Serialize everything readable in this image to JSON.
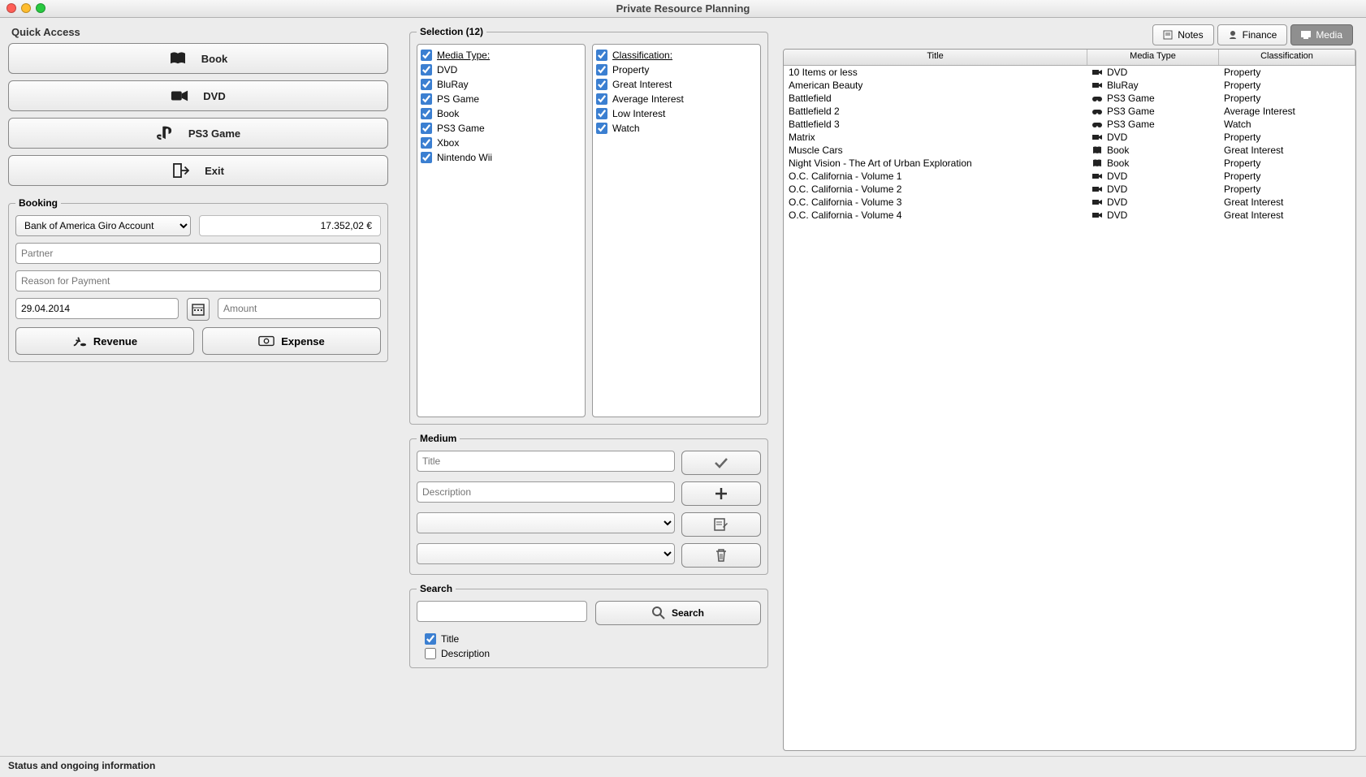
{
  "window": {
    "title": "Private Resource Planning"
  },
  "quick": {
    "title": "Quick Access",
    "book": "Book",
    "dvd": "DVD",
    "ps3": "PS3 Game",
    "exit": "Exit"
  },
  "booking": {
    "title": "Booking",
    "account": "Bank of America Giro Account",
    "balance": "17.352,02 €",
    "partner_ph": "Partner",
    "reason_ph": "Reason for Payment",
    "date": "29.04.2014",
    "amount_ph": "Amount",
    "revenue": "Revenue",
    "expense": "Expense"
  },
  "selection": {
    "title": "Selection (12)",
    "media_hdr": "Media Type:",
    "class_hdr": "Classification:",
    "media": [
      "DVD",
      "BluRay",
      "PS Game",
      "Book",
      "PS3 Game",
      "Xbox",
      "Nintendo Wii"
    ],
    "class": [
      "Property",
      "Great Interest",
      "Average Interest",
      "Low Interest",
      "Watch"
    ]
  },
  "medium": {
    "title": "Medium",
    "title_ph": "Title",
    "desc_ph": "Description"
  },
  "search": {
    "title": "Search",
    "btn": "Search",
    "chk_title": "Title",
    "chk_desc": "Description"
  },
  "tabs": {
    "notes": "Notes",
    "finance": "Finance",
    "media": "Media"
  },
  "table": {
    "headers": {
      "title": "Title",
      "mtype": "Media Type",
      "class": "Classification"
    },
    "rows": [
      {
        "title": "10 Items or less",
        "mtype": "DVD",
        "class": "Property",
        "icon": "dvd"
      },
      {
        "title": "American Beauty",
        "mtype": "BluRay",
        "class": "Property",
        "icon": "dvd"
      },
      {
        "title": "Battlefield",
        "mtype": "PS3 Game",
        "class": "Property",
        "icon": "game"
      },
      {
        "title": "Battlefield 2",
        "mtype": "PS3 Game",
        "class": "Average Interest",
        "icon": "game"
      },
      {
        "title": "Battlefield 3",
        "mtype": "PS3 Game",
        "class": "Watch",
        "icon": "game"
      },
      {
        "title": "Matrix",
        "mtype": "DVD",
        "class": "Property",
        "icon": "dvd"
      },
      {
        "title": "Muscle Cars",
        "mtype": "Book",
        "class": "Great Interest",
        "icon": "book"
      },
      {
        "title": "Night Vision - The Art of Urban Exploration",
        "mtype": "Book",
        "class": "Property",
        "icon": "book"
      },
      {
        "title": "O.C. California - Volume 1",
        "mtype": "DVD",
        "class": "Property",
        "icon": "dvd"
      },
      {
        "title": "O.C. California - Volume 2",
        "mtype": "DVD",
        "class": "Property",
        "icon": "dvd"
      },
      {
        "title": "O.C. California - Volume 3",
        "mtype": "DVD",
        "class": "Great Interest",
        "icon": "dvd"
      },
      {
        "title": "O.C. California - Volume 4",
        "mtype": "DVD",
        "class": "Great Interest",
        "icon": "dvd"
      }
    ]
  },
  "status": "Status and ongoing information"
}
